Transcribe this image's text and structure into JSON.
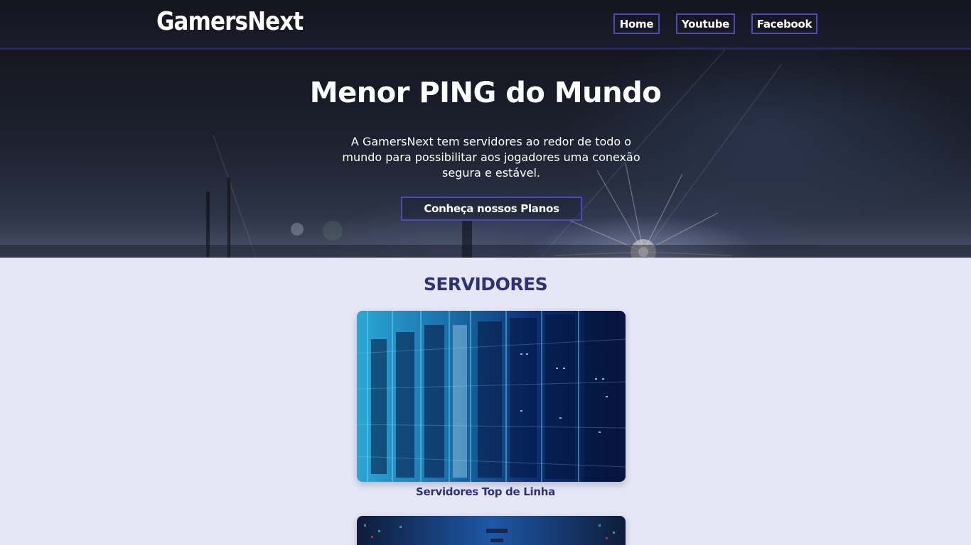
{
  "header": {
    "logo": "GamersNext",
    "nav": {
      "home": "Home",
      "youtube": "Youtube",
      "facebook": "Facebook"
    }
  },
  "hero": {
    "title": "Menor PING do Mundo",
    "text": "A GamersNext tem servidores ao redor de todo o mundo para possibilitar aos jogadores uma conexão segura e estável.",
    "cta_label": "Conheça nossos Planos"
  },
  "servers": {
    "title": "SERVIDORES",
    "cards": [
      {
        "caption": "Servidores Top de Linha"
      },
      {
        "caption": ""
      }
    ]
  },
  "colors": {
    "accent": "#4a4bb8",
    "title": "#2c3178",
    "page_bg": "#e6e6f7",
    "header_bg": "#15151f"
  }
}
